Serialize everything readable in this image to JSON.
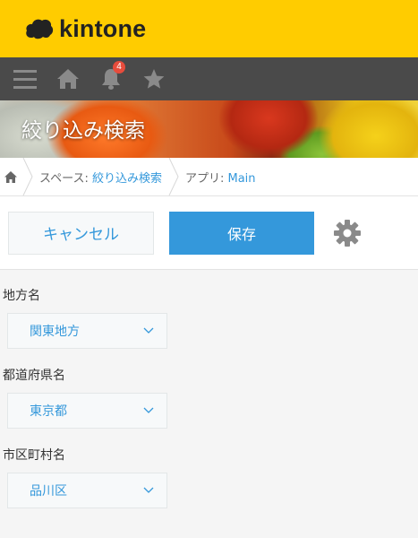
{
  "app": {
    "brand": "kintone"
  },
  "navbar": {
    "notification_count": "4"
  },
  "banner": {
    "title": "絞り込み検索"
  },
  "breadcrumb": {
    "space_prefix": "スペース: ",
    "space_name": "絞り込み検索",
    "app_prefix": "アプリ: ",
    "app_name": "Main"
  },
  "actions": {
    "cancel_label": "キャンセル",
    "save_label": "保存"
  },
  "form": {
    "fields": [
      {
        "label": "地方名",
        "value": "関東地方"
      },
      {
        "label": "都道府県名",
        "value": "東京都"
      },
      {
        "label": "市区町村名",
        "value": "品川区"
      }
    ]
  },
  "colors": {
    "brand_yellow": "#ffcc00",
    "nav_bg": "#4a4a4a",
    "accent_blue": "#3498db",
    "badge_red": "#e74c3c"
  }
}
